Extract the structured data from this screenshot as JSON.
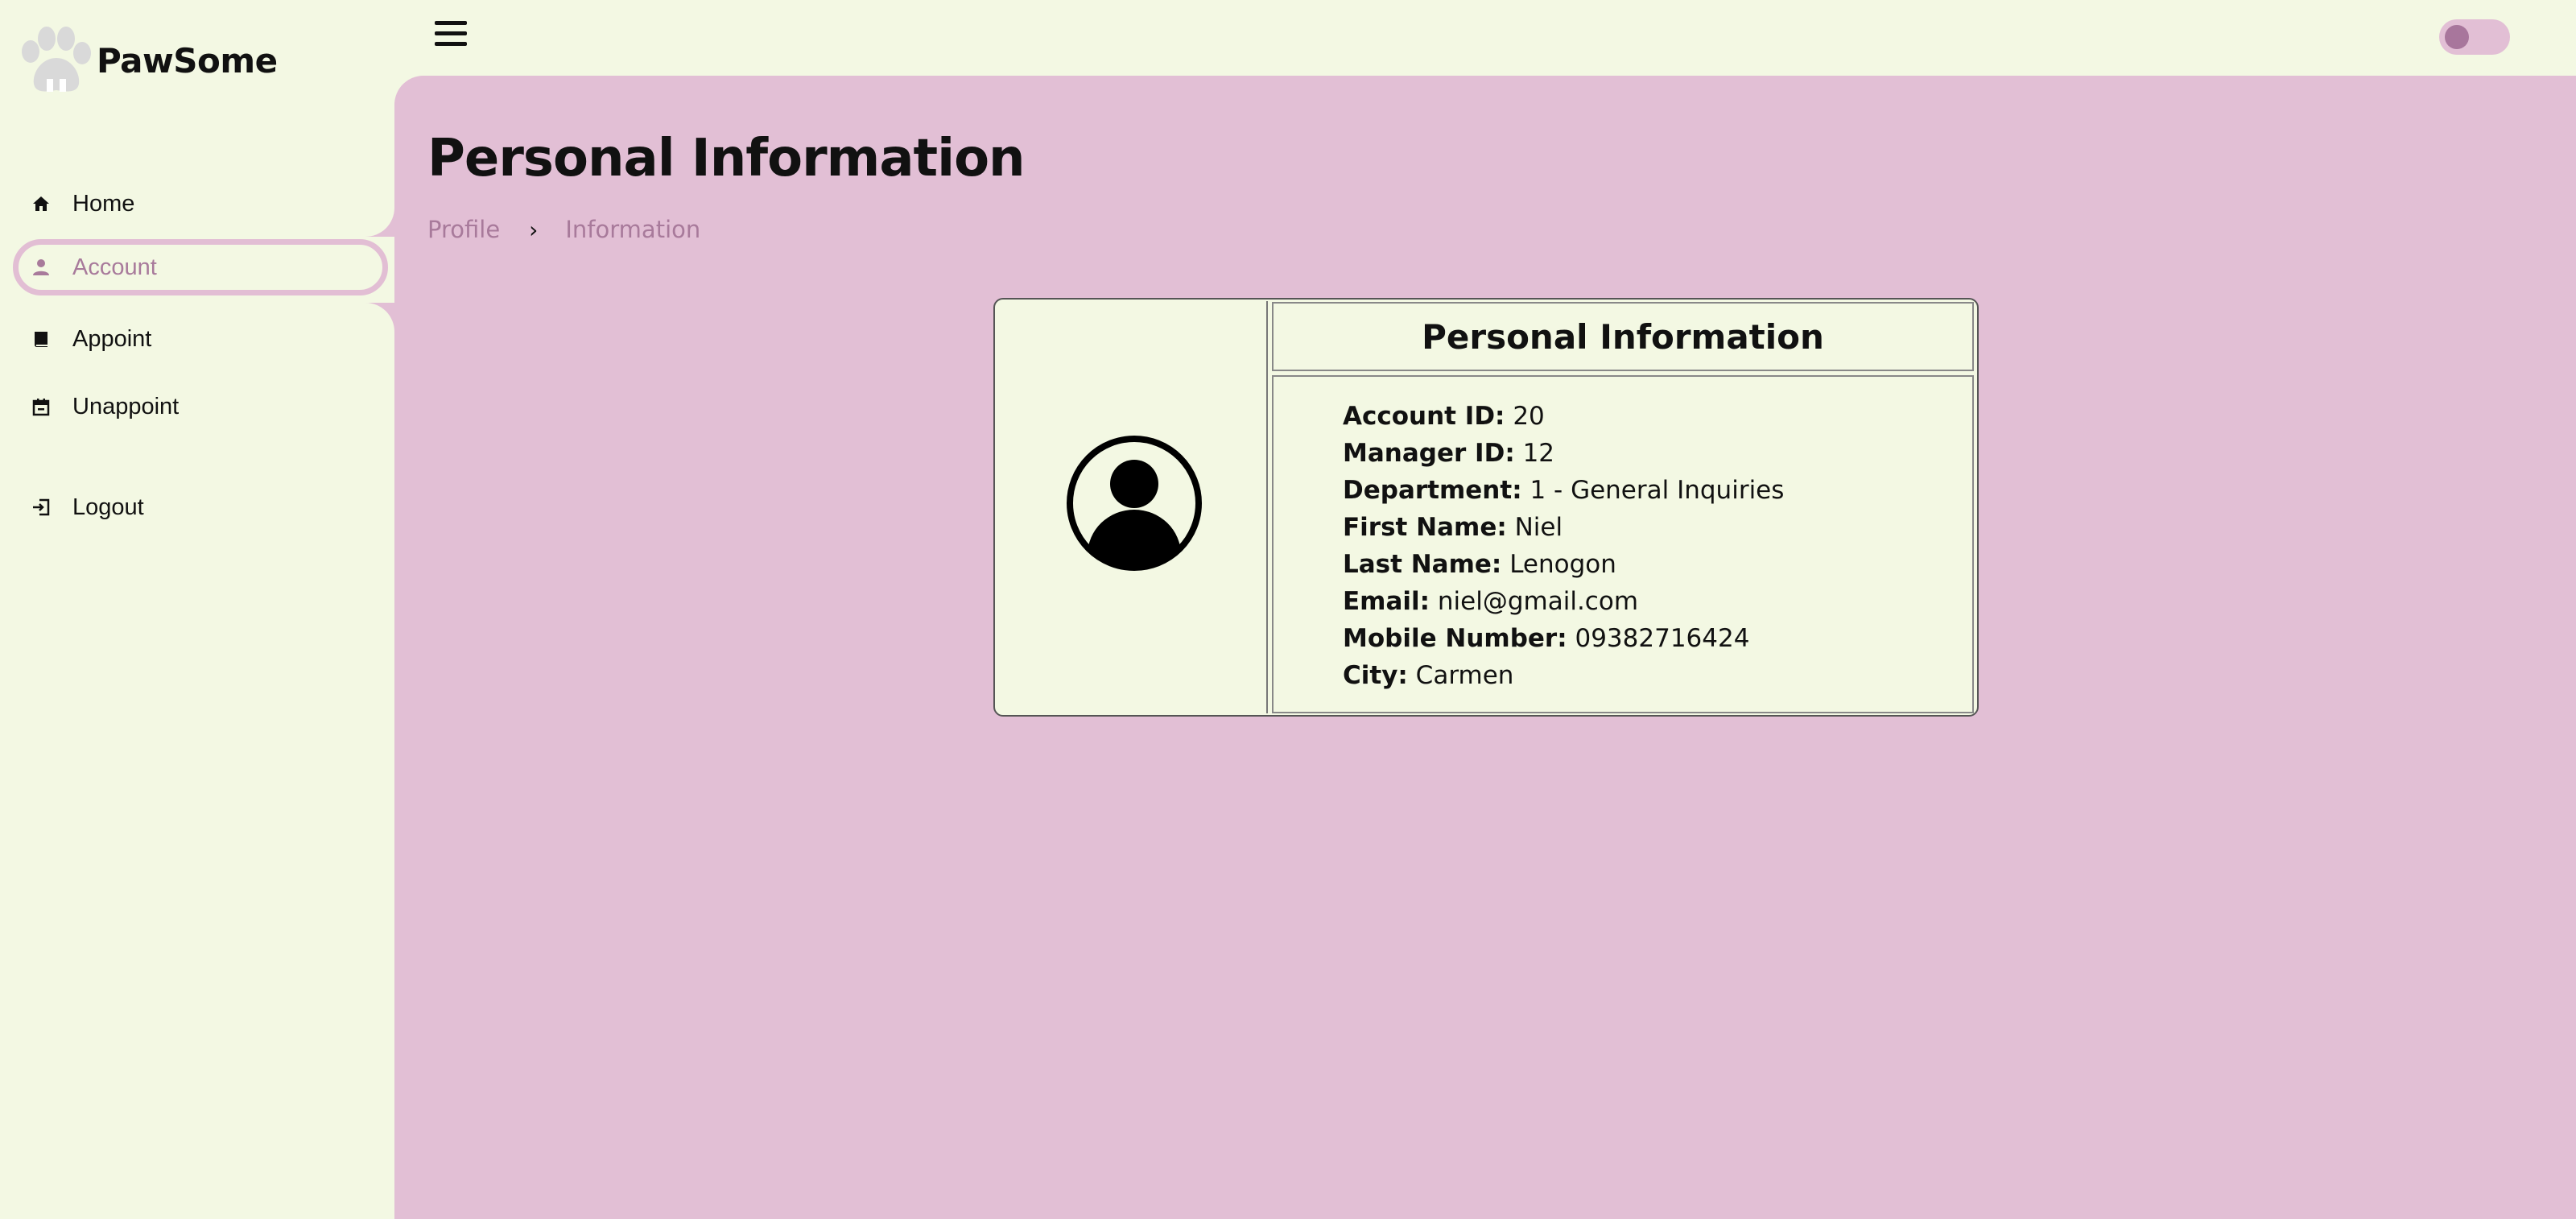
{
  "brand": {
    "name": "PawSome",
    "logo_icon": "paw-icon"
  },
  "sidebar": {
    "items": [
      {
        "label": "Home",
        "icon": "home-icon"
      },
      {
        "label": "Account",
        "icon": "user-icon",
        "active": true
      },
      {
        "label": "Appoint",
        "icon": "book-icon"
      },
      {
        "label": "Unappoint",
        "icon": "calendar-icon"
      },
      {
        "label": "Logout",
        "icon": "logout-icon"
      }
    ]
  },
  "header": {
    "menu_icon": "hamburger-icon",
    "theme_toggle": "off"
  },
  "page": {
    "title": "Personal Information",
    "breadcrumb": [
      "Profile",
      "Information"
    ]
  },
  "card": {
    "title": "Personal Information",
    "avatar_icon": "user-circle-icon",
    "fields": [
      {
        "label": "Account ID:",
        "value": "20"
      },
      {
        "label": "Manager ID:",
        "value": "12"
      },
      {
        "label": "Department:",
        "value": "1 - General Inquiries"
      },
      {
        "label": "First Name:",
        "value": "Niel"
      },
      {
        "label": "Last Name:",
        "value": "Lenogon"
      },
      {
        "label": "Email:",
        "value": "niel@gmail.com"
      },
      {
        "label": "Mobile Number:",
        "value": "09382716424"
      },
      {
        "label": "City:",
        "value": "Carmen"
      }
    ]
  },
  "colors": {
    "sidebar_bg": "#f3f8e3",
    "content_bg": "#e2bfd5",
    "accent": "#a87a9b"
  }
}
